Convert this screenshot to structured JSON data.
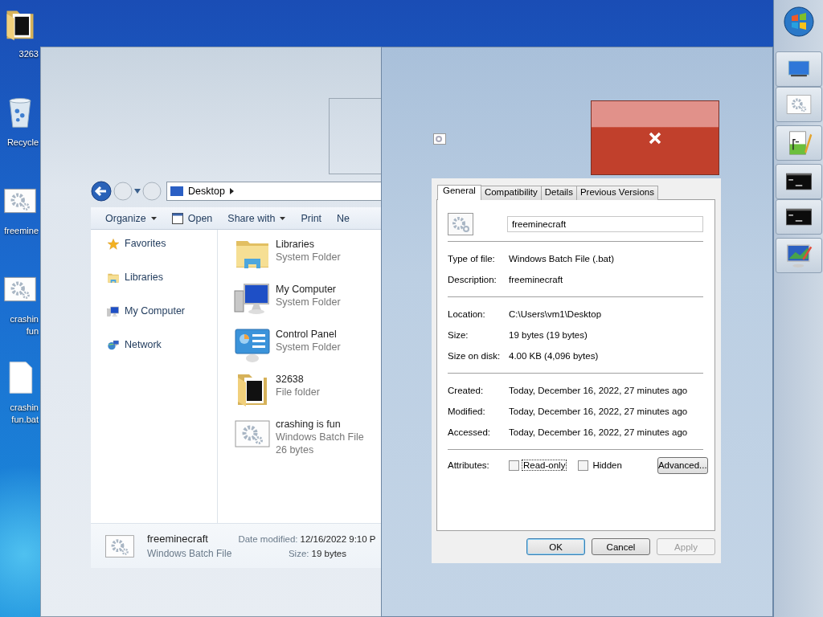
{
  "desktop_icons": [
    {
      "kind": "folder",
      "label_lines": [
        "3263"
      ]
    },
    {
      "kind": "recycle_bin",
      "label_lines": [
        "Recycle"
      ]
    },
    {
      "kind": "batch",
      "label_lines": [
        "freemine"
      ]
    },
    {
      "kind": "batch",
      "label_lines": [
        "crashin",
        "fun"
      ]
    },
    {
      "kind": "blank",
      "label_lines": [
        "crashin",
        "fun.bat"
      ]
    }
  ],
  "explorer": {
    "address": "Desktop",
    "toolbar": [
      {
        "label": "Organize",
        "kind": "menu"
      },
      {
        "label": "Open",
        "kind": "open"
      },
      {
        "label": "Share with",
        "kind": "menu"
      },
      {
        "label": "Print",
        "kind": "plain"
      },
      {
        "label": "Ne",
        "kind": "plain"
      }
    ],
    "navigation": [
      {
        "label": "Favorites",
        "kind": "star"
      },
      {
        "label": "Libraries",
        "kind": "library"
      },
      {
        "label": "My Computer",
        "kind": "computer"
      },
      {
        "label": "Network",
        "kind": "network"
      }
    ],
    "items": [
      {
        "name": "Libraries",
        "lines": [
          "System Folder"
        ],
        "kind": "library"
      },
      {
        "name": "My Computer",
        "lines": [
          "System Folder"
        ],
        "kind": "computer"
      },
      {
        "name": "Control Panel",
        "lines": [
          "System Folder"
        ],
        "kind": "control_panel"
      },
      {
        "name": "32638",
        "lines": [
          "File folder"
        ],
        "kind": "folder"
      },
      {
        "name": "crashing is fun",
        "lines": [
          "Windows Batch File",
          "26 bytes"
        ],
        "kind": "batch"
      }
    ],
    "details": {
      "name": "freeminecraft",
      "type": "Windows Batch File",
      "fields": [
        {
          "label": "Date modified:",
          "value": "12/16/2022 9:10 P"
        },
        {
          "label": "Size:",
          "value": "19 bytes"
        }
      ]
    }
  },
  "properties": {
    "tabs": [
      {
        "label": "General",
        "selected": true
      },
      {
        "label": "Compatibility",
        "selected": false
      },
      {
        "label": "Details",
        "selected": false
      },
      {
        "label": "Previous Versions",
        "selected": false
      }
    ],
    "file_name": "freeminecraft",
    "sections": [
      [
        {
          "label": "Type of file:",
          "value": "Windows Batch File (.bat)"
        },
        {
          "label": "Description:",
          "value": "freeminecraft"
        }
      ],
      [
        {
          "label": "Location:",
          "value": "C:\\Users\\vm1\\Desktop"
        },
        {
          "label": "Size:",
          "value": "19 bytes (19 bytes)"
        },
        {
          "label": "Size on disk:",
          "value": "4.00 KB (4,096 bytes)"
        }
      ],
      [
        {
          "label": "Created:",
          "value": "Today, December 16, 2022, 27 minutes ago"
        },
        {
          "label": "Modified:",
          "value": "Today, December 16, 2022, 27 minutes ago"
        },
        {
          "label": "Accessed:",
          "value": "Today, December 16, 2022, 27 minutes ago"
        }
      ]
    ],
    "attributes_label": "Attributes:",
    "attributes": [
      {
        "label": "Read-only",
        "checked": false,
        "focused": true
      },
      {
        "label": "Hidden",
        "checked": false,
        "focused": false
      }
    ],
    "advanced_button": "Advanced...",
    "buttons": [
      {
        "label": "OK",
        "default": true,
        "disabled": false
      },
      {
        "label": "Cancel",
        "default": false,
        "disabled": false
      },
      {
        "label": "Apply",
        "default": false,
        "disabled": true
      }
    ]
  },
  "taskbar": {
    "groups": [
      {
        "buttons": [
          {
            "kind": "monitor"
          },
          {
            "kind": "batch"
          }
        ]
      },
      {
        "buttons": [
          {
            "kind": "notepad"
          }
        ]
      },
      {
        "buttons": [
          {
            "kind": "terminal"
          },
          {
            "kind": "terminal"
          }
        ]
      },
      {
        "buttons": [
          {
            "kind": "display"
          }
        ]
      }
    ]
  }
}
